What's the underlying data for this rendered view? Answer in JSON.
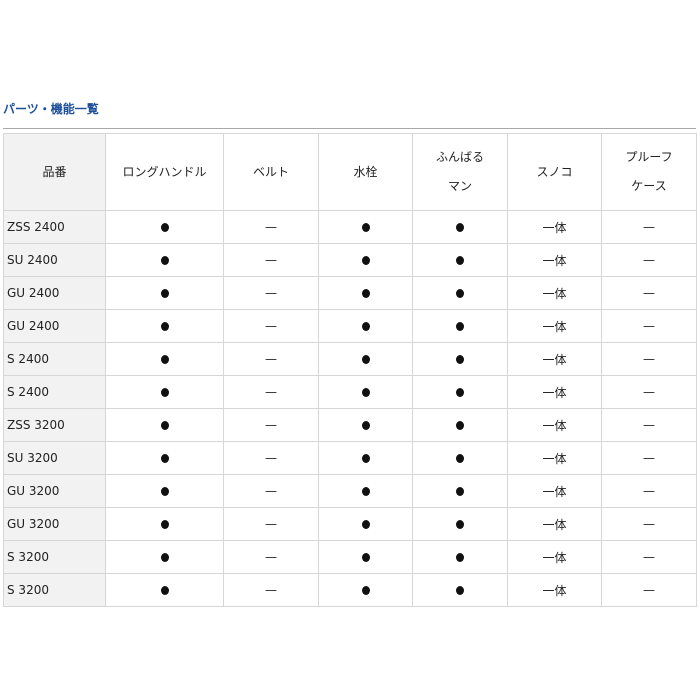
{
  "section": {
    "title": "パーツ・機能一覧"
  },
  "table": {
    "headers": [
      {
        "key": "model",
        "lines": [
          "品番"
        ]
      },
      {
        "key": "long_handle",
        "lines": [
          "ロングハンドル"
        ]
      },
      {
        "key": "belt",
        "lines": [
          "ベルト"
        ]
      },
      {
        "key": "drain_plug",
        "lines": [
          "水栓"
        ]
      },
      {
        "key": "funbaruman",
        "lines": [
          "ふんばる",
          "マン"
        ]
      },
      {
        "key": "sunoko",
        "lines": [
          "スノコ"
        ]
      },
      {
        "key": "proof_case",
        "lines": [
          "プルーフ",
          "ケース"
        ]
      }
    ],
    "rows": [
      {
        "model": "ZSS 2400",
        "long_handle": "●",
        "belt": "—",
        "drain_plug": "●",
        "funbaruman": "●",
        "sunoko": "一体",
        "proof_case": "—"
      },
      {
        "model": "SU 2400",
        "long_handle": "●",
        "belt": "—",
        "drain_plug": "●",
        "funbaruman": "●",
        "sunoko": "一体",
        "proof_case": "—"
      },
      {
        "model": "GU 2400",
        "long_handle": "●",
        "belt": "—",
        "drain_plug": "●",
        "funbaruman": "●",
        "sunoko": "一体",
        "proof_case": "—"
      },
      {
        "model": "GU 2400",
        "long_handle": "●",
        "belt": "—",
        "drain_plug": "●",
        "funbaruman": "●",
        "sunoko": "一体",
        "proof_case": "—"
      },
      {
        "model": "S 2400",
        "long_handle": "●",
        "belt": "—",
        "drain_plug": "●",
        "funbaruman": "●",
        "sunoko": "一体",
        "proof_case": "—"
      },
      {
        "model": "S 2400",
        "long_handle": "●",
        "belt": "—",
        "drain_plug": "●",
        "funbaruman": "●",
        "sunoko": "一体",
        "proof_case": "—"
      },
      {
        "model": "ZSS 3200",
        "long_handle": "●",
        "belt": "—",
        "drain_plug": "●",
        "funbaruman": "●",
        "sunoko": "一体",
        "proof_case": "—"
      },
      {
        "model": "SU 3200",
        "long_handle": "●",
        "belt": "—",
        "drain_plug": "●",
        "funbaruman": "●",
        "sunoko": "一体",
        "proof_case": "—"
      },
      {
        "model": "GU 3200",
        "long_handle": "●",
        "belt": "—",
        "drain_plug": "●",
        "funbaruman": "●",
        "sunoko": "一体",
        "proof_case": "—"
      },
      {
        "model": "GU 3200",
        "long_handle": "●",
        "belt": "—",
        "drain_plug": "●",
        "funbaruman": "●",
        "sunoko": "一体",
        "proof_case": "—"
      },
      {
        "model": "S 3200",
        "long_handle": "●",
        "belt": "—",
        "drain_plug": "●",
        "funbaruman": "●",
        "sunoko": "一体",
        "proof_case": "—"
      },
      {
        "model": "S 3200",
        "long_handle": "●",
        "belt": "—",
        "drain_plug": "●",
        "funbaruman": "●",
        "sunoko": "一体",
        "proof_case": "—"
      }
    ]
  },
  "colors": {
    "title": "#1d4f9a",
    "header_bg": "#f2f2f2",
    "border": "#d6d6d6",
    "rule": "#a9a9a9"
  }
}
